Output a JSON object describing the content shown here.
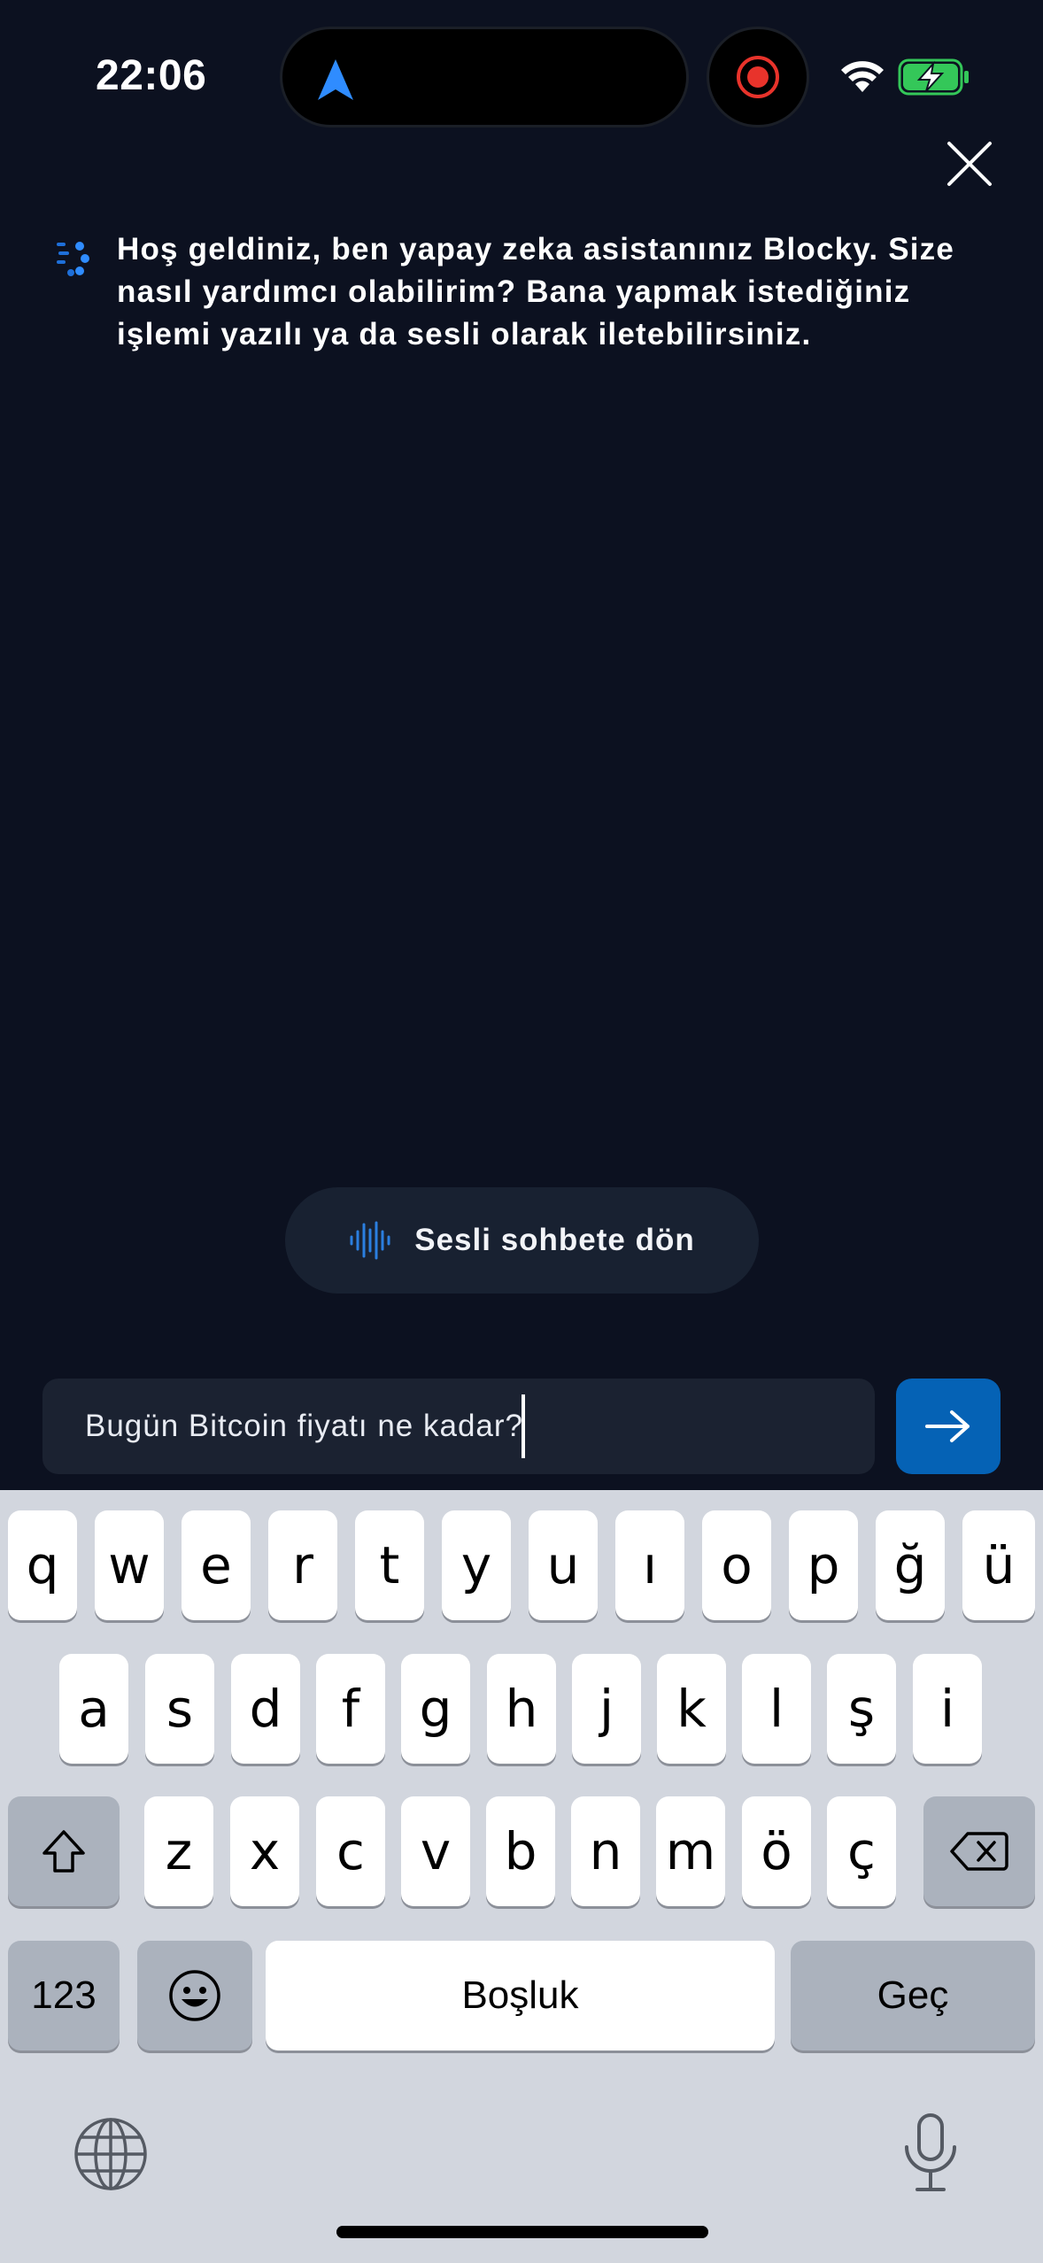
{
  "status_bar": {
    "time": "22:06",
    "icons": [
      "navigation-arrow-icon",
      "screen-record-icon",
      "wifi-icon",
      "battery-charging-icon"
    ],
    "colors": {
      "nav_arrow": "#2f8cff",
      "record": "#e8332b",
      "battery": "#34c759"
    }
  },
  "header": {
    "close_icon": "close-icon"
  },
  "chat": {
    "assistant_icon": "blocky-assistant-icon",
    "assistant_message": "Hoş geldiniz, ben yapay zeka asistanınız Blocky. Size nasıl yardımcı olabilirim? Bana yapmak istediğiniz işlemi yazılı ya da sesli olarak iletebilirsiniz."
  },
  "voice_chat_button": {
    "label": "Sesli sohbete dön",
    "icon": "sound-wave-icon"
  },
  "composer": {
    "input_value": "Bugün Bitcoin fiyatı ne kadar?",
    "send_icon": "arrow-right-icon",
    "send_color": "#0562b5"
  },
  "keyboard": {
    "row1": [
      "q",
      "w",
      "e",
      "r",
      "t",
      "y",
      "u",
      "ı",
      "o",
      "p",
      "ğ",
      "ü"
    ],
    "row2": [
      "a",
      "s",
      "d",
      "f",
      "g",
      "h",
      "j",
      "k",
      "l",
      "ş",
      "i"
    ],
    "row3": [
      "z",
      "x",
      "c",
      "v",
      "b",
      "n",
      "m",
      "ö",
      "ç"
    ],
    "numbers_key": "123",
    "space_key": "Boşluk",
    "return_key": "Geç",
    "icons": [
      "shift-icon",
      "backspace-icon",
      "emoji-icon",
      "globe-icon",
      "microphone-icon"
    ]
  }
}
